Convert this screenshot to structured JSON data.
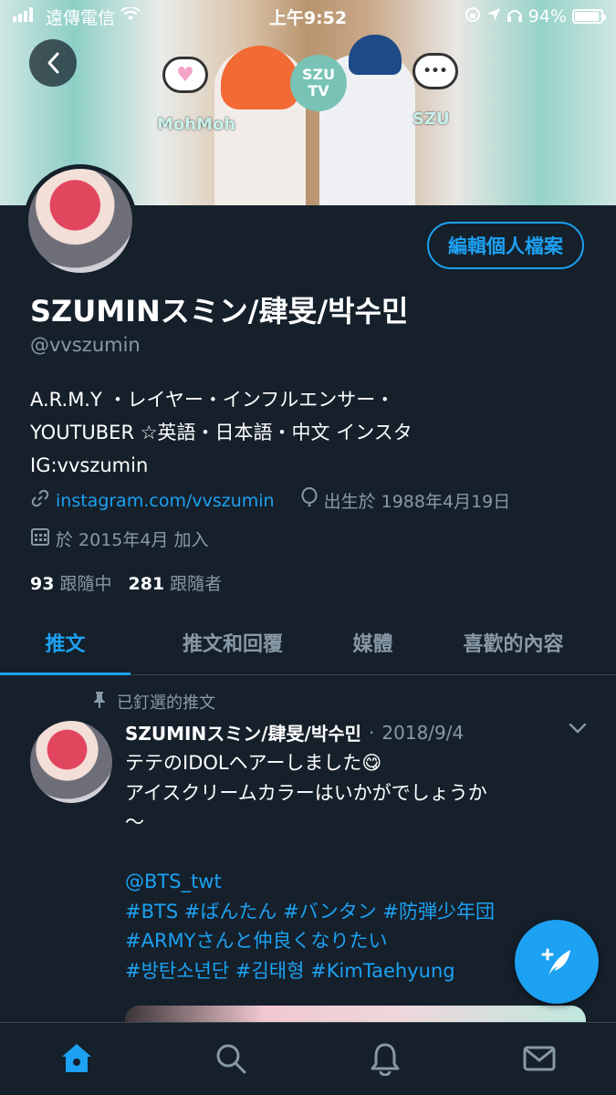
{
  "status_bar": {
    "carrier": "遠傳電信",
    "time": "上午9:52",
    "battery": "94%",
    "battery_level": 0.94
  },
  "banner": {
    "logo_text": "SZU TV",
    "tag_left": "MohMoh",
    "tag_right": "SZU"
  },
  "profile": {
    "edit_button": "編輯個人檔案",
    "display_name": "SZUMINスミン/肆旻/박수민",
    "handle": "@vvszumin",
    "bio_lines": [
      "A.R.M.Y ・レイヤー・インフルエンサー・",
      "YOUTUBER ☆英語・日本語・中文 インスタ",
      "IG:vvszumin"
    ],
    "link": "instagram.com/vvszumin",
    "birthday": "出生於 1988年4月19日",
    "joined": "於 2015年4月 加入",
    "following_count": "93",
    "following_label": "跟隨中",
    "followers_count": "281",
    "followers_label": "跟隨者"
  },
  "tabs": [
    "推文",
    "推文和回覆",
    "媒體",
    "喜歡的內容"
  ],
  "pinned_tweet": {
    "pinned_label": "已釘選的推文",
    "author": "SZUMINスミン/肆旻/박수민",
    "dot": "·",
    "date": "2018/9/4",
    "lines": [
      "テテのIDOLヘアーしました😋",
      "アイスクリームカラーはいかがでしょうか",
      "〜",
      "",
      "@BTS_twt",
      "#BTS #ばんたん #バンタン #防弾少年団",
      "#ARMYさんと仲良くなりたい",
      "#방탄소년단 #김태형 #KimTaehyung"
    ]
  },
  "colors": {
    "background": "#15202b",
    "accent": "#1da1f2",
    "muted": "#8899a6"
  },
  "icons": [
    "back-arrow-icon",
    "wifi-icon",
    "location-icon",
    "headphones-icon",
    "link-icon",
    "balloon-icon",
    "calendar-icon",
    "pin-icon",
    "chevron-down-icon",
    "compose-icon",
    "home-icon",
    "search-icon",
    "bell-icon",
    "mail-icon"
  ]
}
